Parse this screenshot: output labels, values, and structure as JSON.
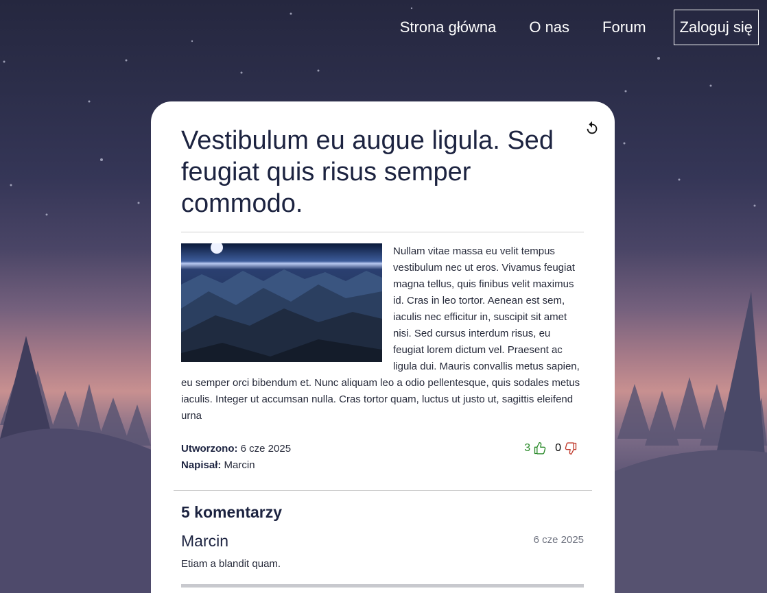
{
  "nav": {
    "home": "Strona główna",
    "about": "O nas",
    "forum": "Forum",
    "login": "Zaloguj się"
  },
  "post": {
    "title": "Vestibulum eu augue ligula. Sed feugiat quis risus semper commodo.",
    "body": "Nullam vitae massa eu velit tempus vestibulum nec ut eros. Vivamus feugiat magna tellus, quis finibus velit maximus id. Cras in leo tortor. Aenean est sem, iaculis nec efficitur in, suscipit sit amet nisi. Sed cursus interdum risus, eu feugiat lorem dictum vel. Praesent ac ligula dui. Mauris convallis metus sapien, eu semper orci bibendum et. Nunc aliquam leo a odio pellentesque, quis sodales metus iaculis. Integer ut accumsan nulla. Cras tortor quam, luctus ut justo ut, sagittis eleifend urna",
    "created_label": "Utworzono:",
    "created_value": "6 cze 2025",
    "author_label": "Napisał:",
    "author_value": "Marcin",
    "likes": "3",
    "dislikes": "0"
  },
  "comments": {
    "heading": "5 komentarzy",
    "items": [
      {
        "author": "Marcin",
        "date": "6 cze 2025",
        "text": "Etiam a blandit quam."
      }
    ]
  },
  "colors": {
    "title": "#1c2340",
    "like": "#2a8a2a",
    "dislike": "#c0392b"
  }
}
